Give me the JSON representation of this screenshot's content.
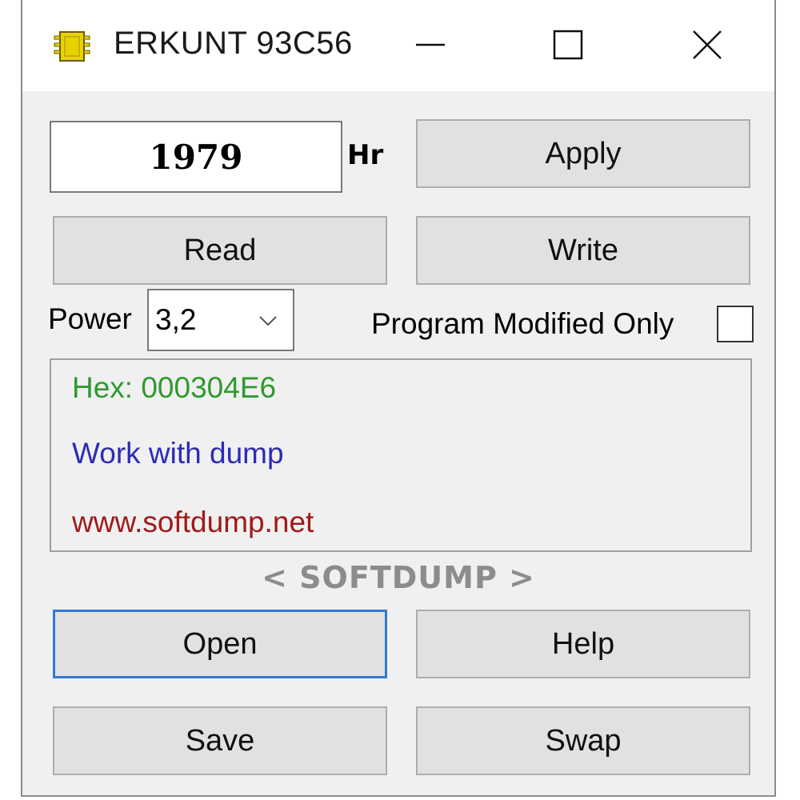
{
  "window": {
    "title": "ERKUNT 93C56",
    "icon": "chip-icon"
  },
  "hours": {
    "value": "1979",
    "unit": "Hr"
  },
  "buttons": {
    "apply": "Apply",
    "read": "Read",
    "write": "Write",
    "open": "Open",
    "help": "Help",
    "save": "Save",
    "swap": "Swap"
  },
  "power": {
    "label": "Power",
    "selected": "3,2"
  },
  "program_modified_only": {
    "label": "Program Modified Only",
    "checked": false
  },
  "log": {
    "lines": [
      {
        "text": "Hex: 000304E6",
        "color": "#2e9a2e"
      },
      {
        "text": "Work with dump",
        "color": "#2b2bb8"
      },
      {
        "text": "www.softdump.net",
        "color": "#a01a1a"
      }
    ]
  },
  "brand": "< SOFTDUMP >",
  "colors": {
    "focus_border": "#2f7ad1",
    "window_bg": "#f0f0f0",
    "button_bg": "#e1e1e1"
  }
}
